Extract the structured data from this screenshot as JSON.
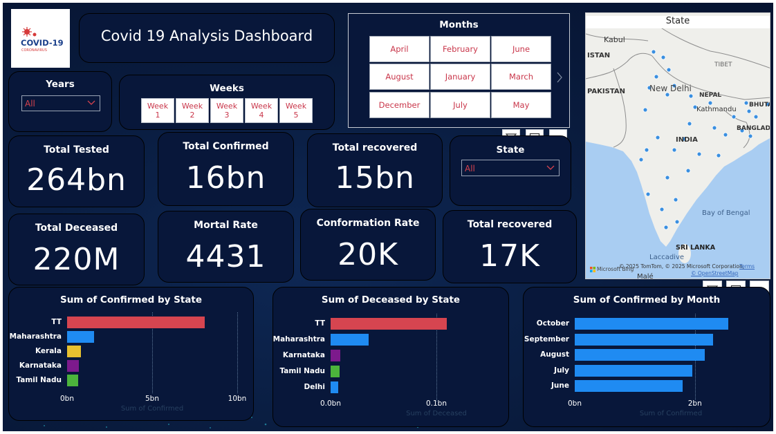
{
  "title": "Covid 19 Analysis Dashboard",
  "logo": {
    "brand": "COVID-19",
    "subtext": "CORONAVIRUS"
  },
  "years": {
    "label": "Years",
    "value": "All"
  },
  "weeks": {
    "label": "Weeks",
    "items": [
      {
        "line1": "Week",
        "line2": "1"
      },
      {
        "line1": "Week",
        "line2": "2"
      },
      {
        "line1": "Week",
        "line2": "3"
      },
      {
        "line1": "Week",
        "line2": "4"
      },
      {
        "line1": "Week",
        "line2": "5"
      }
    ]
  },
  "months": {
    "label": "Months",
    "items": [
      "April",
      "February",
      "June",
      "August",
      "January",
      "March",
      "December",
      "July",
      "May"
    ]
  },
  "state_slicer": {
    "label": "State",
    "value": "All"
  },
  "kpis": {
    "total_tested": {
      "label": "Total Tested",
      "value": "264bn"
    },
    "total_confirmed": {
      "label": "Total Confirmed",
      "value": "16bn"
    },
    "total_recovered": {
      "label": "Total recovered",
      "value": "15bn"
    },
    "total_deceased": {
      "label": "Total Deceased",
      "value": "220M"
    },
    "mortal_rate": {
      "label": "Mortal Rate",
      "value": "4431"
    },
    "conformation_rate": {
      "label": "Conformation Rate",
      "value": "20K"
    },
    "total_recovered_2": {
      "label": "Total recovered",
      "value": "17K"
    }
  },
  "map": {
    "title": "State",
    "labels": {
      "kabul": "Kabul",
      "istan": "ISTAN",
      "pakistan": "PAKISTAN",
      "new_delhi": "New Delhi",
      "tibet": "TIBET",
      "nepal": "NEPAL",
      "kathmandu": "Kathmandu",
      "bhutan": "BHUTA",
      "bangladesh": "BANGLAD",
      "india": "INDIA",
      "bay": "Bay of Bengal",
      "laccadive": "Laccadive",
      "sri_lanka": "SRI LANKA",
      "male": "Malé"
    },
    "attribution": "© 2025 TomTom, © 2025 Microsoft Corporation,",
    "terms": "Terms",
    "osm": "© OpenStreetMap",
    "bing": "Microsoft Bing"
  },
  "chart_data": [
    {
      "type": "bar",
      "title": "Sum of Confirmed by State",
      "categories": [
        "TT",
        "Maharashtra",
        "Kerala",
        "Karnataka",
        "Tamil Nadu"
      ],
      "values": [
        8.1,
        1.6,
        0.8,
        0.7,
        0.65
      ],
      "colors": [
        "#d64550",
        "#1f8bf2",
        "#e8c12f",
        "#7d1a8c",
        "#4cb43c"
      ],
      "xlim": [
        0,
        10
      ],
      "ticks": [
        0,
        5,
        10
      ],
      "tick_labels": [
        "0bn",
        "5bn",
        "10bn"
      ],
      "xlabel": "Sum of Confirmed"
    },
    {
      "type": "bar",
      "title": "Sum of Deceased by State",
      "categories": [
        "TT",
        "Maharashtra",
        "Karnataka",
        "Tamil Nadu",
        "Delhi"
      ],
      "values": [
        0.11,
        0.036,
        0.009,
        0.0085,
        0.007
      ],
      "colors": [
        "#d64550",
        "#1f8bf2",
        "#7d1a8c",
        "#4cb43c",
        "#1f8bf2"
      ],
      "xlim": [
        0,
        0.2
      ],
      "ticks": [
        0,
        0.1
      ],
      "tick_labels": [
        "0.0bn",
        "0.1bn"
      ],
      "xlabel": "Sum of Deceased"
    },
    {
      "type": "bar",
      "title": "Sum of Confirmed by Month",
      "categories": [
        "October",
        "September",
        "August",
        "July",
        "June"
      ],
      "values": [
        2.56,
        2.3,
        2.16,
        1.96,
        1.8
      ],
      "colors": [
        "#1f8bf2",
        "#1f8bf2",
        "#1f8bf2",
        "#1f8bf2",
        "#1f8bf2"
      ],
      "xlim": [
        0,
        3.2
      ],
      "ticks": [
        0,
        2
      ],
      "tick_labels": [
        "0bn",
        "2bn"
      ],
      "xlabel": "Sum of Confirmed"
    }
  ]
}
